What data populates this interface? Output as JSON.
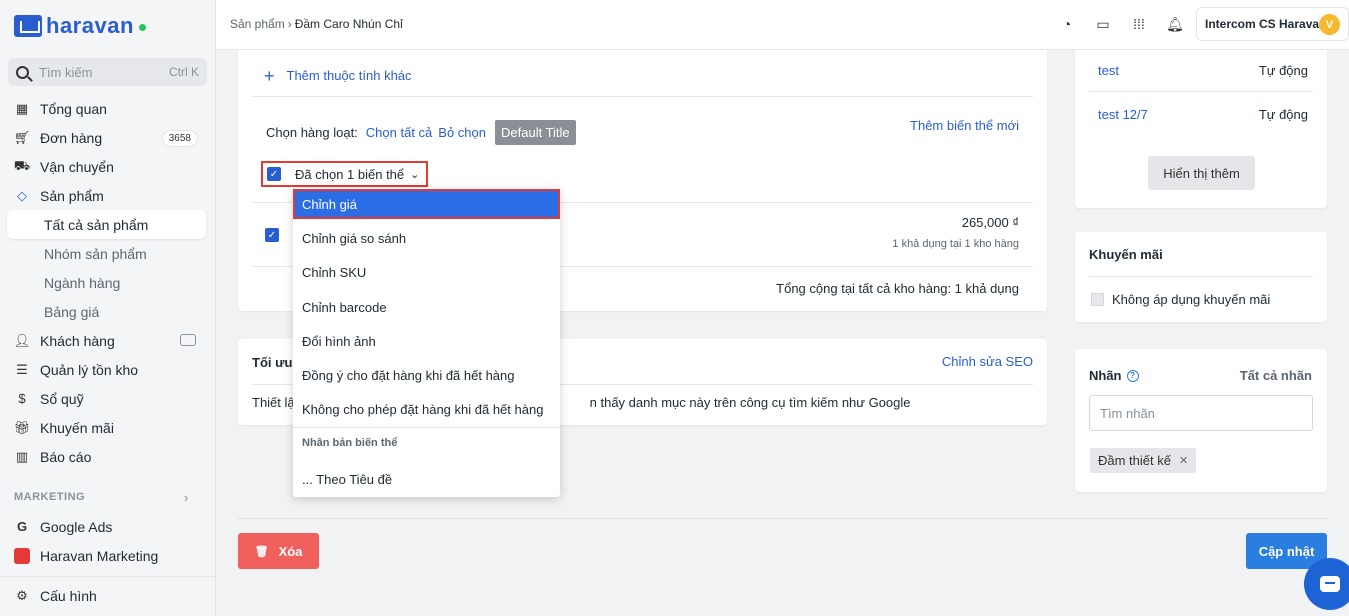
{
  "brand": {
    "name": "haravan"
  },
  "search": {
    "placeholder": "Tìm kiếm",
    "shortcut": "Ctrl K"
  },
  "sidebar": {
    "items": [
      {
        "label": "Tổng quan",
        "icon": "dashboard-icon"
      },
      {
        "label": "Đơn hàng",
        "icon": "cart-icon",
        "badge": "3658"
      },
      {
        "label": "Vận chuyển",
        "icon": "truck-icon"
      },
      {
        "label": "Sản phẩm",
        "icon": "tag-icon"
      }
    ],
    "product_sub": [
      {
        "label": "Tất cả sản phẩm",
        "active": true
      },
      {
        "label": "Nhóm sản phẩm"
      },
      {
        "label": "Ngành hàng"
      },
      {
        "label": "Bảng giá"
      }
    ],
    "items2": [
      {
        "label": "Khách hàng",
        "icon": "user-icon"
      },
      {
        "label": "Quản lý tồn kho",
        "icon": "inventory-icon"
      },
      {
        "label": "Sổ quỹ",
        "icon": "cashbook-icon"
      },
      {
        "label": "Khuyến mãi",
        "icon": "gift-icon"
      },
      {
        "label": "Báo cáo",
        "icon": "chart-icon"
      }
    ],
    "marketing_label": "MARKETING",
    "marketing": [
      {
        "label": "Google Ads",
        "icon": "google-icon"
      },
      {
        "label": "Haravan Marketing",
        "icon": "haravan-marketing-icon"
      }
    ],
    "settings": {
      "label": "Cấu hình",
      "icon": "gear-icon"
    }
  },
  "header": {
    "breadcrumb": [
      "Sản phẩm",
      "Đầm Caro Nhún Chỉ"
    ],
    "account": "Intercom CS Haravan",
    "avatar_initial": "V"
  },
  "variants": {
    "add_attribute": "Thêm thuộc tính khác",
    "bulk_label": "Chọn hàng loạt:",
    "select_all": "Chọn tất cả",
    "deselect": "Bỏ chọn",
    "default_title": "Default Title",
    "add_variant": "Thêm biến thể mới",
    "selected_label": "Đã chọn 1 biến thể",
    "price": "265,000 ₫",
    "available": "1 khả dụng tại 1 kho hàng",
    "total": "Tổng cộng tại tất cả kho hàng: 1 khả dụng"
  },
  "dropdown": {
    "items": [
      "Chỉnh giá",
      "Chỉnh giá so sánh",
      "Chỉnh SKU",
      "Chỉnh barcode",
      "Đổi hình ảnh",
      "Đồng ý cho đặt hàng khi đã hết hàng",
      "Không cho phép đặt hàng khi đã hết hàng"
    ],
    "section_title": "Nhân bản biến thể",
    "section_item": "... Theo Tiêu đề"
  },
  "seo": {
    "title": "Tối ưu",
    "edit": "Chỉnh sửa SEO",
    "desc_start": "Thiết lậ",
    "desc_end": "n thấy danh mục này trên công cụ tìm kiếm như Google"
  },
  "channels": {
    "rows": [
      {
        "name": "test",
        "mode": "Tự động"
      },
      {
        "name": "test 12/7",
        "mode": "Tự động"
      }
    ],
    "show_more": "Hiển thị thêm"
  },
  "promotion": {
    "title": "Khuyến mãi",
    "checkbox": "Không áp dụng khuyến mãi"
  },
  "tags": {
    "title": "Nhãn",
    "all": "Tất cả nhãn",
    "placeholder": "Tìm nhãn",
    "chip": "Đầm thiết kế"
  },
  "actions": {
    "delete": "Xóa",
    "update": "Cập nhật"
  },
  "colors": {
    "primary": "#2a5ed0",
    "danger": "#f0605d",
    "highlight": "#e53935",
    "update": "#2a7de1"
  }
}
